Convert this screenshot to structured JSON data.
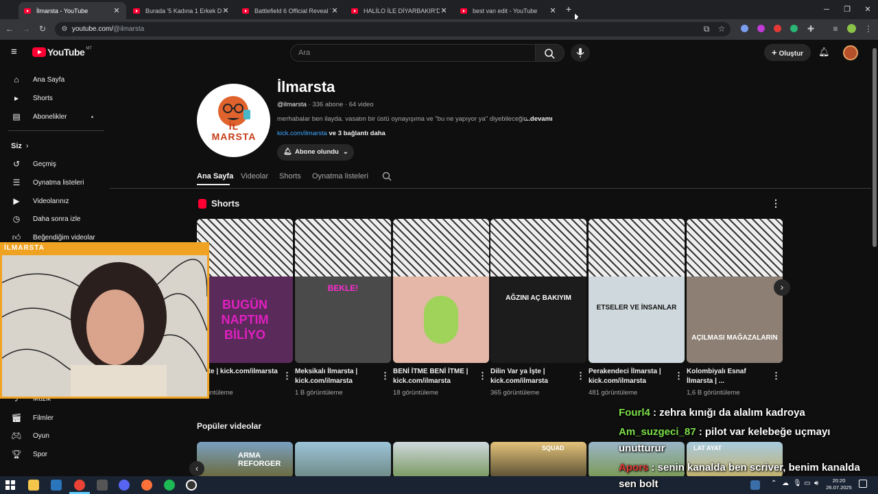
{
  "browser": {
    "tabs": [
      {
        "title": "İlmarsta - YouTube",
        "active": true
      },
      {
        "title": "Burada '5 Kadına 1 Erkek Düşüy",
        "active": false
      },
      {
        "title": "Battlefield 6 Official Reveal Trai",
        "active": false
      },
      {
        "title": "HALİLO İLE DİYARBAKIR'DA BİR",
        "active": false
      },
      {
        "title": "best van edit - YouTube",
        "active": false
      }
    ],
    "url_host": "youtube.com/",
    "url_path": "@ilmarsta",
    "new_tab": "+",
    "close": "✕"
  },
  "youtube": {
    "logo": "YouTube",
    "logo_sup": "MT",
    "search_placeholder": "Ara",
    "create_label": "Oluştur"
  },
  "sidebar": {
    "items_top": [
      {
        "label": "Ana Sayfa",
        "icon": "home-icon"
      },
      {
        "label": "Shorts",
        "icon": "shorts-icon"
      },
      {
        "label": "Abonelikler",
        "icon": "subscriptions-icon"
      }
    ],
    "you_header": "Siz",
    "items_you": [
      {
        "label": "Geçmiş",
        "icon": "history-icon"
      },
      {
        "label": "Oynatma listeleri",
        "icon": "playlists-icon"
      },
      {
        "label": "Videolarınız",
        "icon": "your-videos-icon"
      },
      {
        "label": "Daha sonra izle",
        "icon": "watch-later-icon"
      },
      {
        "label": "Beğendiğim videolar",
        "icon": "liked-icon"
      }
    ],
    "partial_label": "Müzik",
    "items_explore": [
      {
        "label": "Filmler",
        "icon": "films-icon"
      },
      {
        "label": "Oyun",
        "icon": "gaming-icon"
      },
      {
        "label": "Spor",
        "icon": "sports-icon"
      }
    ]
  },
  "channel": {
    "name": "İlmarsta",
    "handle": "@ilmarsta",
    "meta": " · 336 abone · 64 video",
    "description": "merhabalar ben ilayda. vasatın bir üstü oynayışıma ve \"bu ne yapıyor ya\" diyebileceğin",
    "more": "...devamı",
    "link": "kick.com/ilmarsta",
    "link_more": " ve 3 bağlantı daha",
    "subscribed_label": "Abone olundu",
    "avatar_text": "İL MARSTA"
  },
  "nav_tabs": [
    {
      "label": "Ana Sayfa",
      "active": true
    },
    {
      "label": "Videolar",
      "active": false
    },
    {
      "label": "Shorts",
      "active": false
    },
    {
      "label": "Oynatma listeleri",
      "active": false
    }
  ],
  "shorts": {
    "heading": "Shorts",
    "items": [
      {
        "title": "Köfte | kick.com/ilmarsta",
        "views": "görüntüleme",
        "thumb_text": "BUGÜN NAPTIM BİLİYO"
      },
      {
        "title": "Meksikalı İlmarsta | kick.com/ilmarsta",
        "views": "1 B görüntüleme",
        "thumb_text": "BEKLE!"
      },
      {
        "title": "BENİ İTME BENİ İTME | kick.com/ilmarsta",
        "views": "18 görüntüleme",
        "thumb_text": ""
      },
      {
        "title": "Dilin Var ya İşte | kick.com/ilmarsta",
        "views": "365 görüntüleme",
        "thumb_text": "AĞZINI AÇ BAKIYIM"
      },
      {
        "title": "Perakendeci İlmarsta | kick.com/ilmarsta",
        "views": "481 görüntüleme",
        "thumb_text": "ETSELER VE İNSANLAR"
      },
      {
        "title": "Kolombiyalı Esnaf İlmarsta | ...",
        "views": "1,6 B görüntüleme",
        "thumb_text": "AÇILMASI MAĞAZALARIN"
      }
    ]
  },
  "popular": {
    "heading": "Popüler videolar",
    "thumb_text": [
      "ARMA REFORGER",
      "",
      "",
      "SQUAD",
      "",
      "LAT AYAT"
    ]
  },
  "overlay": {
    "title": "İLMARSTA"
  },
  "chat": [
    {
      "user": "Fourl4",
      "msg": " : zehra kınığı da alalım kadroya"
    },
    {
      "user": "Am_suzgeci_87",
      "msg": " : pilot var kelebeğe uçmayı"
    },
    {
      "user": "",
      "msg": "unutturur"
    },
    {
      "user": "Apors",
      "msg": " : senin kanalda ben scriver, benim kanalda"
    },
    {
      "user": "",
      "msg": "sen bolt"
    }
  ],
  "taskbar": {
    "time": "20:20",
    "date": "26.07.2025"
  },
  "colors": {
    "accent_red": "#ff0033",
    "overlay_border": "#f0a323",
    "chat_user_green": "#7ee04a",
    "link_blue": "#3ea6ff"
  }
}
